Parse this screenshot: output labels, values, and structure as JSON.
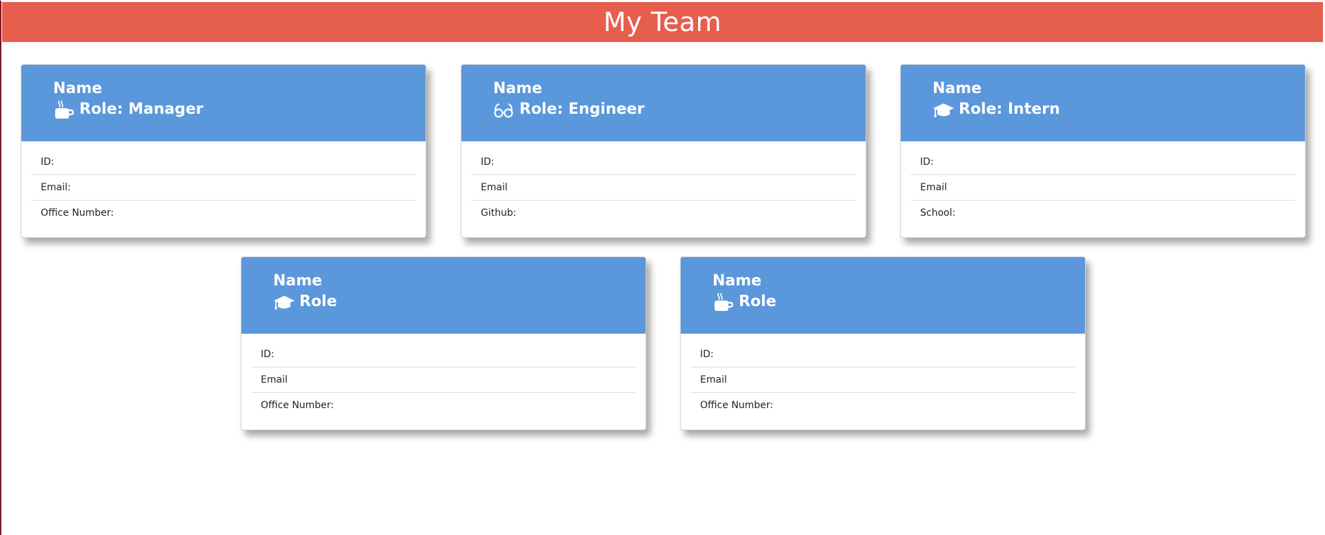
{
  "header": {
    "title": "My Team"
  },
  "colors": {
    "header_bg": "#e65e4e",
    "card_head_bg": "#5b97db"
  },
  "cards": [
    {
      "name": "Name",
      "role": "Role: Manager",
      "icon": "coffee-mug-icon",
      "rows": [
        "ID:",
        "Email:",
        "Office Number:"
      ]
    },
    {
      "name": "Name",
      "role": "Role: Engineer",
      "icon": "glasses-icon",
      "rows": [
        "ID:",
        "Email",
        "Github:"
      ]
    },
    {
      "name": "Name",
      "role": "Role: Intern",
      "icon": "graduation-cap-icon",
      "rows": [
        "ID:",
        "Email",
        "School:"
      ]
    },
    {
      "name": "Name",
      "role": "Role",
      "icon": "graduation-cap-icon",
      "rows": [
        "ID:",
        "Email",
        "Office Number:"
      ]
    },
    {
      "name": "Name",
      "role": "Role",
      "icon": "coffee-mug-icon",
      "rows": [
        "ID:",
        "Email",
        "Office Number:"
      ]
    }
  ]
}
